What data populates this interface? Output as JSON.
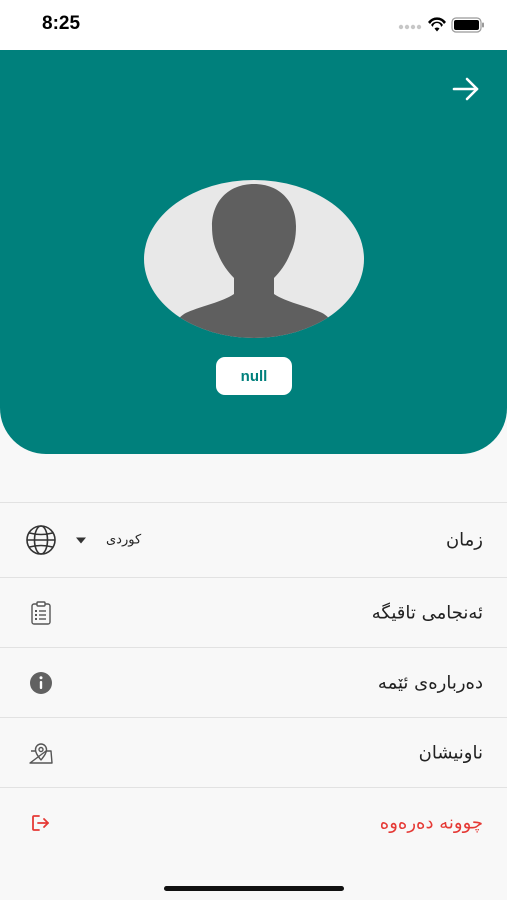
{
  "status_bar": {
    "time": "8:25"
  },
  "profile": {
    "name": "null"
  },
  "menu": {
    "language": {
      "label": "زمان",
      "selected": "کوردی",
      "icon": "globe-icon"
    },
    "quiz_results": {
      "label": "ئەنجامی تاقیگە",
      "icon": "clipboard-icon"
    },
    "about": {
      "label": "دەربارەی ئێمە",
      "icon": "info-icon"
    },
    "address": {
      "label": "ناونیشان",
      "icon": "map-pin-icon"
    },
    "logout": {
      "label": "چوونە دەرەوە",
      "icon": "logout-icon"
    }
  },
  "colors": {
    "primary": "#00807c",
    "danger": "#e53935",
    "avatar_bg": "#e8e8e8",
    "avatar_silhouette": "#5f5f5f"
  }
}
